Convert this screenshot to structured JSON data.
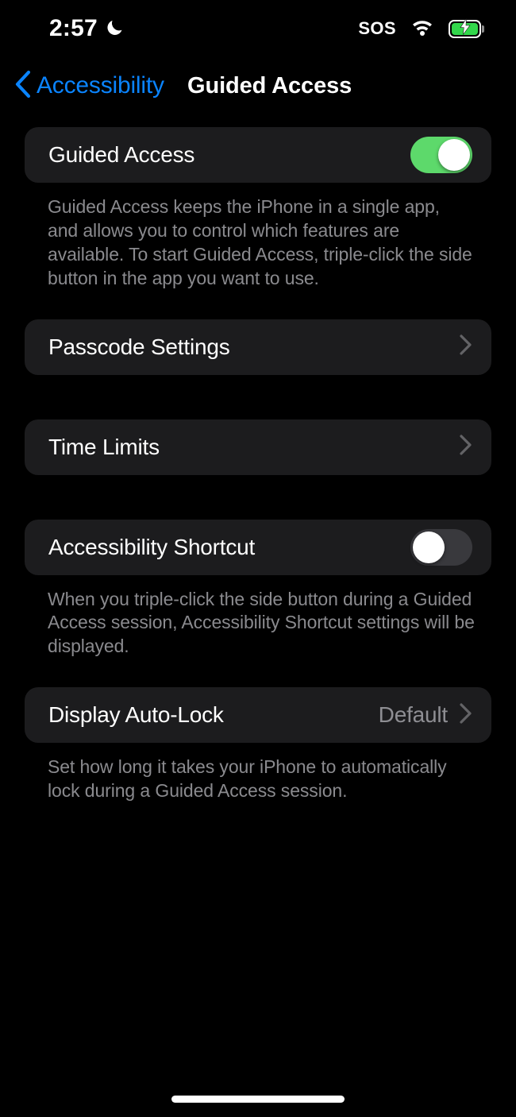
{
  "status_bar": {
    "time": "2:57",
    "focus_icon": "crescent-moon-icon",
    "sos_label": "SOS",
    "wifi_icon": "wifi-icon",
    "battery_icon": "battery-charging-icon",
    "battery_charging": true
  },
  "nav": {
    "back_label": "Accessibility",
    "back_icon": "chevron-left-icon",
    "title": "Guided Access",
    "back_color": "#0A84FF"
  },
  "sections": {
    "guided_access": {
      "label": "Guided Access",
      "toggle_state": "on",
      "toggle_on_color": "#5DD96B",
      "footnote": "Guided Access keeps the iPhone in a single app, and allows you to control which features are available. To start Guided Access, triple-click the side button in the app you want to use."
    },
    "passcode_settings": {
      "label": "Passcode Settings",
      "disclosure_icon": "chevron-right-icon"
    },
    "time_limits": {
      "label": "Time Limits",
      "disclosure_icon": "chevron-right-icon"
    },
    "accessibility_shortcut": {
      "label": "Accessibility Shortcut",
      "toggle_state": "off",
      "toggle_off_color": "#39393D",
      "footnote": "When you triple-click the side button during a Guided Access session, Accessibility Shortcut settings will be displayed."
    },
    "display_auto_lock": {
      "label": "Display Auto-Lock",
      "value": "Default",
      "disclosure_icon": "chevron-right-icon",
      "footnote": "Set how long it takes your iPhone to automatically lock during a Guided Access session."
    }
  },
  "home_indicator": "home-indicator"
}
